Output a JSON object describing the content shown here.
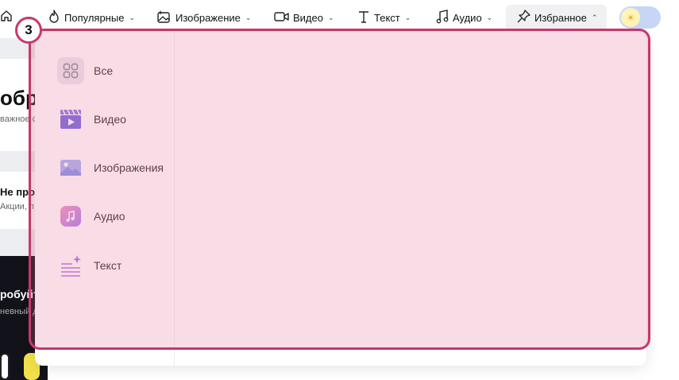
{
  "nav": {
    "items": [
      {
        "label": "Популярные",
        "icon": "fire-icon"
      },
      {
        "label": "Изображение",
        "icon": "image-sparkle-icon"
      },
      {
        "label": "Видео",
        "icon": "video-camera-icon"
      },
      {
        "label": "Текст",
        "icon": "text-t-icon"
      },
      {
        "label": "Аудио",
        "icon": "music-note-icon"
      },
      {
        "label": "Избранное",
        "icon": "pin-icon"
      }
    ],
    "chevron_down": "⌄",
    "chevron_up": "⌃",
    "theme_toggle_symbol": "☀"
  },
  "background": {
    "card1_title": "обро",
    "card1_sub": "важное с",
    "card2_title": "Не прог",
    "card2_sub": "Акции, п",
    "dark_title": "робуйт",
    "dark_sub": "невный д"
  },
  "dropdown": {
    "items": [
      {
        "label": "Все",
        "icon": "grid-icon"
      },
      {
        "label": "Видео",
        "icon": "video-clapper-icon"
      },
      {
        "label": "Изображения",
        "icon": "image-icon"
      },
      {
        "label": "Аудио",
        "icon": "music-icon"
      },
      {
        "label": "Текст",
        "icon": "text-sparkle-icon"
      }
    ]
  },
  "annotation": {
    "number": "3",
    "color": "#c8376c"
  }
}
